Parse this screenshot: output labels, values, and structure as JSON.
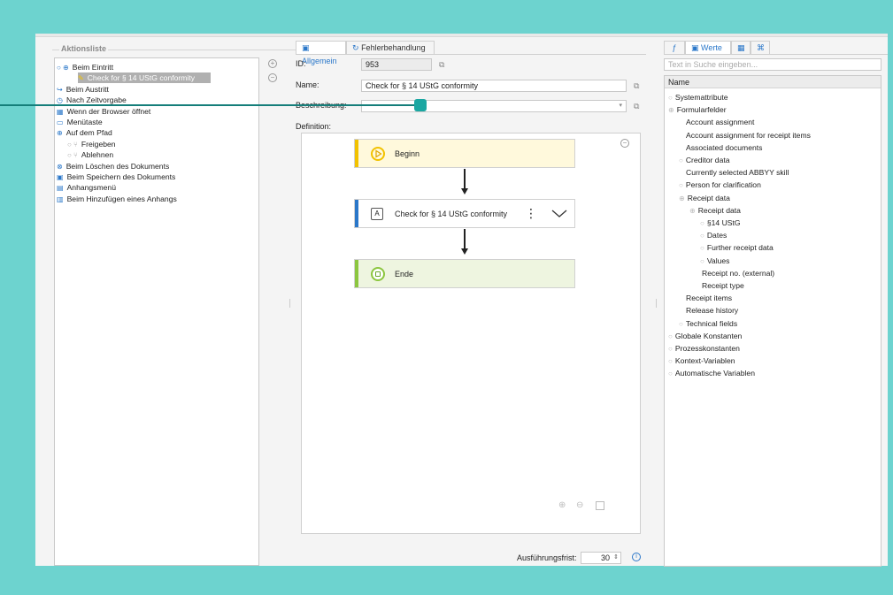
{
  "left": {
    "legend": "Aktionsliste",
    "items": [
      {
        "label": "Beim Eintritt",
        "icon": "○ ⊕",
        "indent": 0,
        "color": "blue"
      },
      {
        "label": "Check for § 14 UStG conformity",
        "icon": "✎",
        "indent": 2,
        "selected": true
      },
      {
        "label": "Beim Austritt",
        "icon": "↪",
        "indent": 0,
        "color": "blue"
      },
      {
        "label": "Nach Zeitvorgabe",
        "icon": "◷",
        "indent": 0,
        "color": "blue"
      },
      {
        "label": "Wenn der Browser öffnet",
        "icon": "▦",
        "indent": 0,
        "color": "blue"
      },
      {
        "label": "Menütaste",
        "icon": "▭",
        "indent": 0,
        "color": "blue"
      },
      {
        "label": "Auf dem Pfad",
        "icon": "⊕",
        "indent": 0,
        "color": "blue"
      },
      {
        "label": "Freigeben",
        "icon": "○ ⑂",
        "indent": 1,
        "color": "grey"
      },
      {
        "label": "Ablehnen",
        "icon": "○ ⑂",
        "indent": 1,
        "color": "grey"
      },
      {
        "label": "Beim Löschen des Dokuments",
        "icon": "⊗",
        "indent": 0,
        "color": "blue"
      },
      {
        "label": "Beim Speichern des Dokuments",
        "icon": "▣",
        "indent": 0,
        "color": "blue"
      },
      {
        "label": "Anhangsmenü",
        "icon": "▤",
        "indent": 0,
        "color": "blue"
      },
      {
        "label": "Beim Hinzufügen eines Anhangs",
        "icon": "▥",
        "indent": 0,
        "color": "blue"
      }
    ]
  },
  "mid": {
    "tab_general": "Allgemein",
    "tab_error": "Fehlerbehandlung",
    "id_label": "ID:",
    "id_value": "953",
    "name_label": "Name:",
    "name_value": "Check for § 14 UStG conformity",
    "desc_label": "Beschreibung:",
    "def_label": "Definition:",
    "nodes": {
      "start": "Beginn",
      "action": "Check for § 14 UStG conformity",
      "end": "Ende"
    },
    "deadline_label": "Ausführungsfrist:",
    "deadline_value": "30"
  },
  "right": {
    "tab_values": "Werte",
    "search_placeholder": "Text in Suche eingeben...",
    "header": "Name",
    "items": [
      {
        "label": "Systemattribute",
        "indent": 0,
        "ex": "○"
      },
      {
        "label": "Formularfelder",
        "indent": 0,
        "ex": "⊕"
      },
      {
        "label": "Account assignment",
        "indent": 1,
        "ex": ""
      },
      {
        "label": "Account assignment for receipt items",
        "indent": 1,
        "ex": ""
      },
      {
        "label": "Associated documents",
        "indent": 1,
        "ex": ""
      },
      {
        "label": "Creditor data",
        "indent": 1,
        "ex": "○"
      },
      {
        "label": "Currently selected ABBYY skill",
        "indent": 1,
        "ex": ""
      },
      {
        "label": "Person for clarification",
        "indent": 1,
        "ex": "○"
      },
      {
        "label": "Receipt data",
        "indent": 1,
        "ex": "⊕"
      },
      {
        "label": "Receipt data",
        "indent": 2,
        "ex": "⊕"
      },
      {
        "label": "§14 UStG",
        "indent": 3,
        "ex": "○"
      },
      {
        "label": "Dates",
        "indent": 3,
        "ex": "○"
      },
      {
        "label": "Further receipt data",
        "indent": 3,
        "ex": "○"
      },
      {
        "label": "Values",
        "indent": 3,
        "ex": "○"
      },
      {
        "label": "Receipt no. (external)",
        "indent": 2.5,
        "ex": ""
      },
      {
        "label": "Receipt type",
        "indent": 2.5,
        "ex": ""
      },
      {
        "label": "Receipt items",
        "indent": 1,
        "ex": ""
      },
      {
        "label": "Release history",
        "indent": 1,
        "ex": ""
      },
      {
        "label": "Technical fields",
        "indent": 1,
        "ex": "○"
      },
      {
        "label": "Globale Konstanten",
        "indent": 0,
        "ex": "○"
      },
      {
        "label": "Prozesskonstanten",
        "indent": 0,
        "ex": "○"
      },
      {
        "label": "Kontext-Variablen",
        "indent": 0,
        "ex": "○"
      },
      {
        "label": "Automatische Variablen",
        "indent": 0,
        "ex": "○"
      }
    ]
  },
  "colors": {
    "background": "#6dd3cf",
    "accent": "#2a77c9",
    "start_bar": "#f2c200",
    "action_bar": "#2a77c9",
    "end_bar": "#8cc63f",
    "callout": "#1aa7a2"
  }
}
